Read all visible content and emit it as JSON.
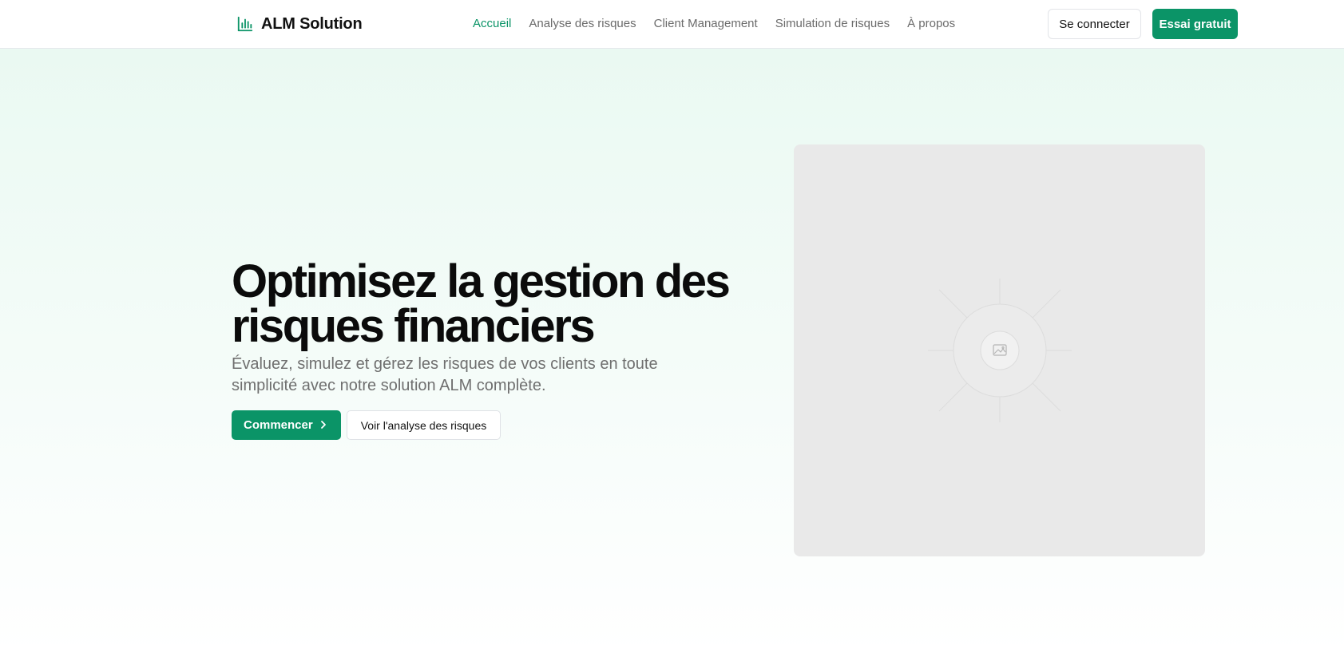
{
  "header": {
    "brand_name": "ALM Solution",
    "brand_icon": "bar-chart-icon",
    "nav": [
      {
        "label": "Accueil",
        "active": true
      },
      {
        "label": "Analyse des risques",
        "active": false
      },
      {
        "label": "Client Management",
        "active": false
      },
      {
        "label": "Simulation de risques",
        "active": false
      },
      {
        "label": "À propos",
        "active": false
      }
    ],
    "login_label": "Se connecter",
    "trial_label": "Essai gratuit"
  },
  "hero": {
    "title": "Optimisez la gestion des risques financiers",
    "subtitle": "Évaluez, simulez et gérez les risques de vos clients en toute simplicité avec notre solution ALM complète.",
    "primary_cta": "Commencer",
    "primary_cta_icon": "chevron-right-icon",
    "secondary_cta": "Voir l'analyse des risques",
    "image_icon": "image-placeholder-icon"
  },
  "colors": {
    "accent": "#0b9467",
    "nav_text": "#6b6b6b",
    "hero_bg_top": "#eaf9f2",
    "placeholder_bg": "#e9e9e9"
  }
}
